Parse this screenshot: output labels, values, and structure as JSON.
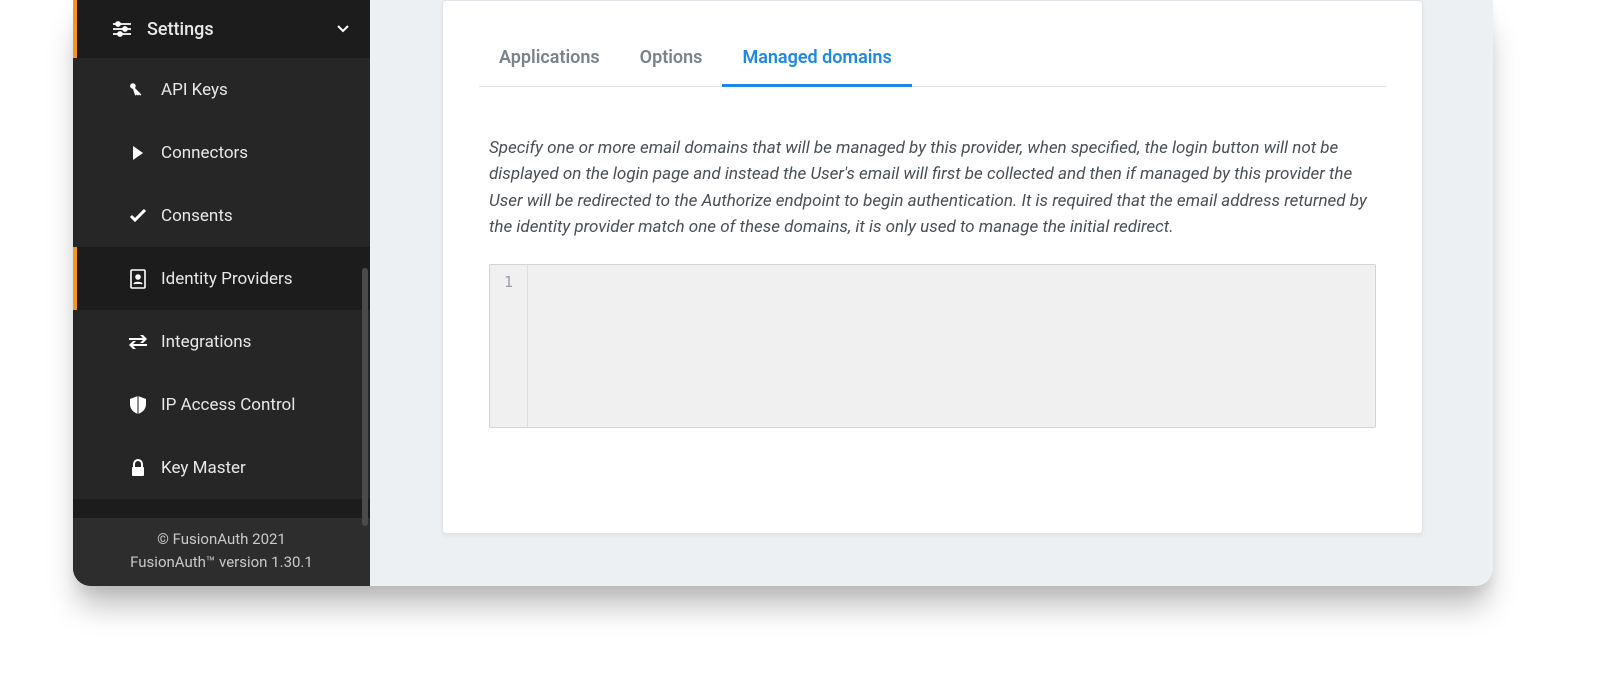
{
  "sidebar": {
    "header": {
      "label": "Settings"
    },
    "items": [
      {
        "label": "API Keys",
        "active": false
      },
      {
        "label": "Connectors",
        "active": false
      },
      {
        "label": "Consents",
        "active": false
      },
      {
        "label": "Identity Providers",
        "active": true
      },
      {
        "label": "Integrations",
        "active": false
      },
      {
        "label": "IP Access Control",
        "active": false
      },
      {
        "label": "Key Master",
        "active": false
      }
    ]
  },
  "footer": {
    "copyright": "© FusionAuth 2021",
    "version": "FusionAuth™ version 1.30.1"
  },
  "main": {
    "tabs": [
      {
        "label": "Applications",
        "active": false
      },
      {
        "label": "Options",
        "active": false
      },
      {
        "label": "Managed domains",
        "active": true
      }
    ],
    "help_text": "Specify one or more email domains that will be managed by this provider, when specified, the login button will not be displayed on the login page and instead the User's email will first be collected and then if managed by this provider the User will be redirected to the Authorize endpoint to begin authentication. It is required that the email address returned by the identity provider match one of these domains, it is only used to manage the initial redirect.",
    "editor": {
      "first_line_number": "1",
      "content": ""
    }
  }
}
